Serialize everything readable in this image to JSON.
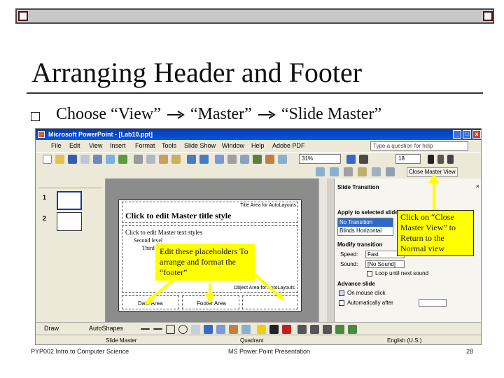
{
  "slide": {
    "title": "Arranging Header and Footer",
    "bullet_parts": [
      "Choose “View”",
      "“Master”",
      "“Slide Master”"
    ]
  },
  "app": {
    "window_title": "Microsoft PowerPoint - [Lab10.ppt]",
    "menu": [
      "File",
      "Edit",
      "View",
      "Insert",
      "Format",
      "Tools",
      "Slide Show",
      "Window",
      "Help",
      "Adobe PDF"
    ],
    "help_placeholder": "Type a question for help",
    "zoom": "31%",
    "font_size": "18",
    "close_master_view": "Close Master View",
    "thumbnails": [
      "1",
      "2"
    ],
    "master": {
      "title_area_label": "Title Area for AutoLayouts",
      "title_text": "Click to edit Master title style",
      "text_styles": "Click to edit Master text styles",
      "second_level": "Second level",
      "third_level": "Third level",
      "object_area_label": "Object Area for AutoLayouts",
      "date_area": "Date Area",
      "footer_area": "Footer Area"
    },
    "task_pane": {
      "title": "Slide Transition",
      "apply_label": "Apply to selected slides:",
      "transitions": [
        "No Transition",
        "Blinds Horizontal"
      ],
      "modify_label": "Modify transition",
      "speed_label": "Speed:",
      "speed_value": "Fast",
      "sound_label": "Sound:",
      "sound_value": "[No Sound]",
      "loop_label": "Loop until next sound",
      "advance_label": "Advance slide",
      "on_click_label": "On mouse click",
      "auto_label": "Automatically after"
    },
    "draw_label": "Draw",
    "autoshapes_label": "AutoShapes",
    "status": {
      "view": "Slide Master",
      "design": "Quadrant",
      "language": "English (U.S.)"
    }
  },
  "callouts": {
    "placeholders": "Edit these placeholders To arrange and format the “footer”",
    "close_view": "Click on “Close Master View” to Return to the Normal view"
  },
  "footer": {
    "left": "PYP002 Intro.to Computer Science",
    "center": "MS Power.Point Presentation",
    "page": "28"
  },
  "colors": {
    "accent_yellow": "#ffff00",
    "title_blue": "#0a3aa8",
    "frame_border": "#5a0a0a"
  }
}
